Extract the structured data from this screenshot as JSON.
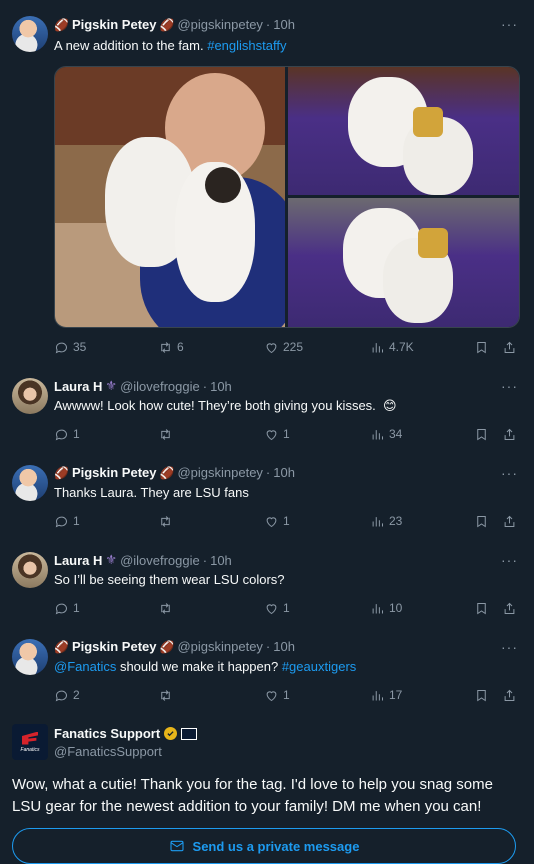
{
  "tweets": [
    {
      "name": "Pigskin Petey",
      "handle": "@pigskinpetey",
      "sep": "·",
      "time": "10h",
      "text_plain": "A new addition to the fam. ",
      "hashtag": "#englishstaffy",
      "replies": "35",
      "retweets": "6",
      "likes": "225",
      "views": "4.7K"
    },
    {
      "name": "Laura H",
      "handle": "@ilovefroggie",
      "sep": "·",
      "time": "10h",
      "text_plain": "Awwww!  Look how cute! They’re both giving you kisses.",
      "emoji": "😊",
      "replies": "1",
      "likes": "1",
      "views": "34"
    },
    {
      "name": "Pigskin Petey",
      "handle": "@pigskinpetey",
      "sep": "·",
      "time": "10h",
      "text_plain": "Thanks Laura. They are LSU fans",
      "replies": "1",
      "likes": "1",
      "views": "23"
    },
    {
      "name": "Laura H",
      "handle": "@ilovefroggie",
      "sep": "·",
      "time": "10h",
      "text_plain": "So I’ll be seeing them wear LSU colors?",
      "replies": "1",
      "likes": "1",
      "views": "10"
    },
    {
      "name": "Pigskin Petey",
      "handle": "@pigskinpetey",
      "sep": "·",
      "time": "10h",
      "mention": "@Fanatics",
      "text_plain": " should we make it happen? ",
      "hashtag": "#geauxtigers",
      "replies": "2",
      "likes": "1",
      "views": "17"
    }
  ],
  "fanatics": {
    "name": "Fanatics Support",
    "handle": "@FanaticsSupport",
    "avatar_text": "Fanatics",
    "body": "Wow, what a cutie! Thank you for the tag. I'd love to help you snag some LSU gear for the newest addition to your family! DM me when you can!",
    "button": "Send us a private message"
  },
  "more_glyph": "···",
  "icons": {
    "football": "football-emoji",
    "fleur": "fleur-de-lis-emoji"
  },
  "colors": {
    "background": "#15202b",
    "accent": "#1d9bf0",
    "muted": "#8b98a5",
    "verified": "#e7b51a"
  }
}
